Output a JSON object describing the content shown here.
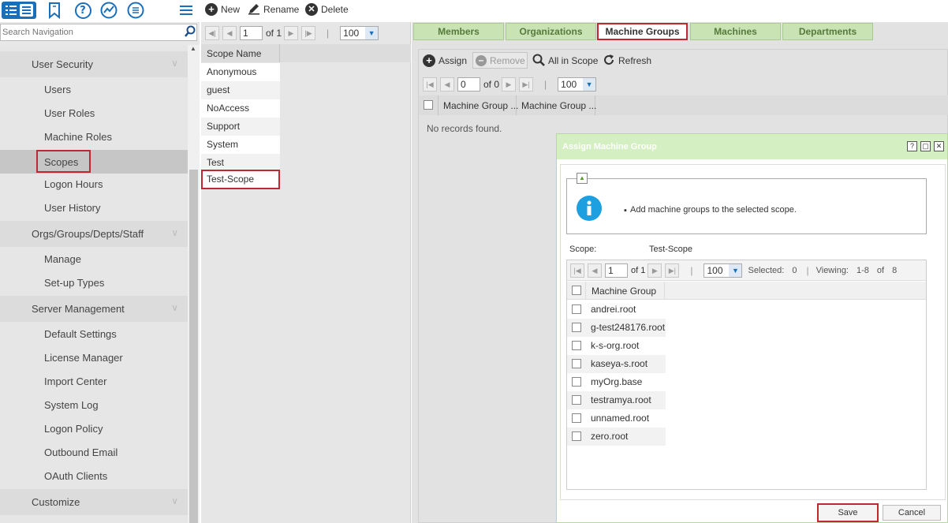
{
  "nav": {
    "search_placeholder": "Search Navigation",
    "categories": [
      {
        "label": "User Security"
      },
      {
        "label": "Orgs/Groups/Depts/Staff"
      },
      {
        "label": "Server Management"
      },
      {
        "label": "Customize"
      }
    ],
    "items": [
      {
        "label": "Users"
      },
      {
        "label": "User Roles"
      },
      {
        "label": "Machine Roles"
      },
      {
        "label": "Scopes"
      },
      {
        "label": "Logon Hours"
      },
      {
        "label": "User History"
      },
      {
        "label": "Manage"
      },
      {
        "label": "Set-up Types"
      },
      {
        "label": "Default Settings"
      },
      {
        "label": "License Manager"
      },
      {
        "label": "Import Center"
      },
      {
        "label": "System Log"
      },
      {
        "label": "Logon Policy"
      },
      {
        "label": "Outbound Email"
      },
      {
        "label": "OAuth Clients"
      }
    ]
  },
  "toolbar": {
    "new_label": "New",
    "rename_label": "Rename",
    "delete_label": "Delete"
  },
  "scopes": {
    "page_value": "1",
    "of_label": "of 1",
    "page_size": "100",
    "column_header": "Scope Name",
    "rows": [
      "Anonymous",
      "guest",
      "NoAccess",
      "Support",
      "System",
      "Test",
      "Test-Scope"
    ]
  },
  "tabs": [
    {
      "label": "Members"
    },
    {
      "label": "Organizations"
    },
    {
      "label": "Machine Groups"
    },
    {
      "label": "Machines"
    },
    {
      "label": "Departments"
    }
  ],
  "machine_groups": {
    "assign_label": "Assign",
    "remove_label": "Remove",
    "all_in_scope_label": "All in Scope",
    "refresh_label": "Refresh",
    "page_value": "0",
    "of_label": "of 0",
    "page_size": "100",
    "columns": [
      "Machine Group ...",
      "Machine Group ..."
    ],
    "empty_text": "No records found."
  },
  "dialog": {
    "title": "Assign Machine Group",
    "info_text": "Add machine groups to the selected scope.",
    "scope_label": "Scope:",
    "scope_value": "Test-Scope",
    "page_value": "1",
    "of_label": "of 1",
    "page_size": "100",
    "selected_label": "Selected:",
    "selected_value": "0",
    "viewing_label": "Viewing:",
    "viewing_value": "1-8",
    "of_word": "of",
    "total_value": "8",
    "column_header": "Machine Group",
    "rows": [
      "andrei.root",
      "g-test248176.root",
      "k-s-org.root",
      "kaseya-s.root",
      "myOrg.base",
      "testramya.root",
      "unnamed.root",
      "zero.root"
    ],
    "save_label": "Save",
    "cancel_label": "Cancel"
  },
  "colors": {
    "accent_blue": "#1a6fb8",
    "highlight_red": "#c0282d",
    "tab_green": "#c9e3b5",
    "dialog_header_green": "#d4efc2"
  }
}
